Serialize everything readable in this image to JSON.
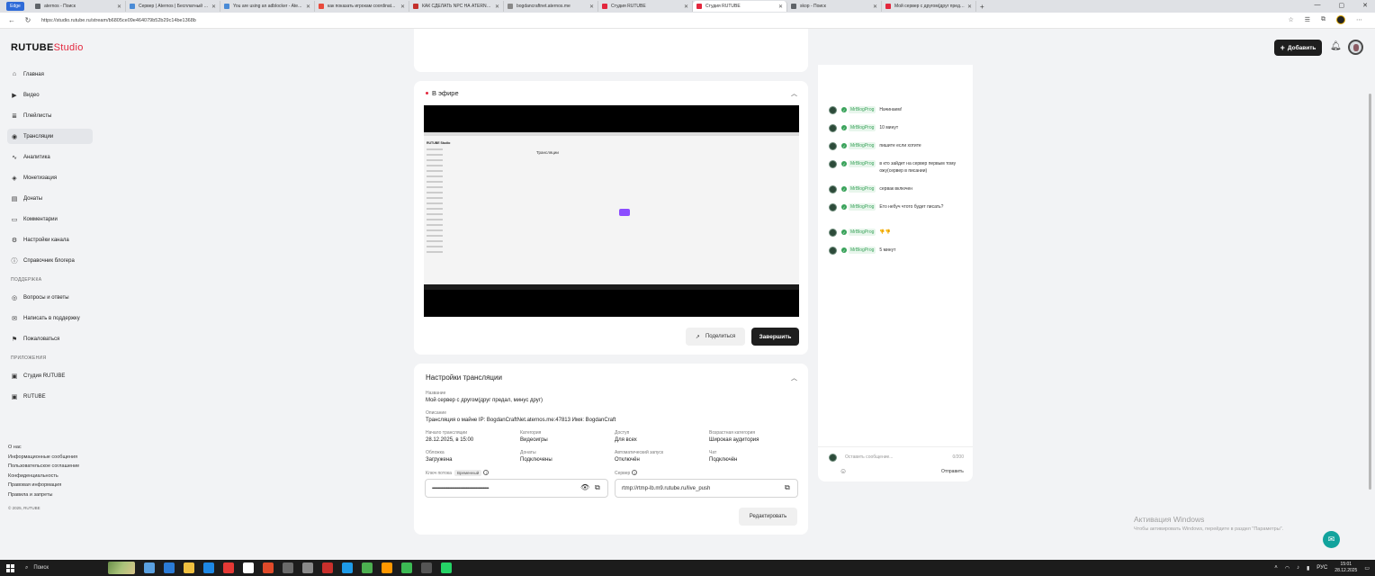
{
  "browser": {
    "edge_label": "Edge",
    "tabs": [
      {
        "title": "aternos - Поиск",
        "color": "#5f6368"
      },
      {
        "title": "Сервер | Aternos | Бесплатный с...",
        "color": "#4a8bd6"
      },
      {
        "title": "You are using an adblocker - Ate...",
        "color": "#4a8bd6"
      },
      {
        "title": "как показать игрокам coordinat...",
        "color": "#e84a3c"
      },
      {
        "title": "КАК СДЕЛАТЬ NPC НА ATERNOS...",
        "color": "#c4302b"
      },
      {
        "title": "bogdancraftnet.aternos.me",
        "color": "#888888"
      },
      {
        "title": "Студия RUTUBE",
        "color": "#e3273d"
      },
      {
        "title": "Студия RUTUBE",
        "color": "#e3273d"
      },
      {
        "title": "skop - Поиск",
        "color": "#5f6368"
      },
      {
        "title": "Мой сервер с другом(друг преда...",
        "color": "#e3273d"
      }
    ],
    "new_tab": "+",
    "window_controls": [
      "—",
      "▢",
      "✕"
    ],
    "url": "https://studio.rutube.ru/stream/b6805ce09e464079b52b29c14be1368b"
  },
  "header": {
    "logo_main": "RUTUBE",
    "logo_studio": "Studio",
    "add_label": "Добавить",
    "add_icon": "+"
  },
  "sidebar": {
    "items": [
      {
        "label": "Главная",
        "icon": "⌂",
        "name": "home"
      },
      {
        "label": "Видео",
        "icon": "▶",
        "name": "video"
      },
      {
        "label": "Плейлисты",
        "icon": "≣",
        "name": "playlists"
      },
      {
        "label": "Трансляции",
        "icon": "◉",
        "name": "streams"
      },
      {
        "label": "Аналитика",
        "icon": "∿",
        "name": "analytics"
      },
      {
        "label": "Монетизация",
        "icon": "◈",
        "name": "monetization"
      },
      {
        "label": "Донаты",
        "icon": "▤",
        "name": "donations"
      },
      {
        "label": "Комментарии",
        "icon": "▭",
        "name": "comments"
      },
      {
        "label": "Настройки канала",
        "icon": "⚙",
        "name": "channel-settings"
      },
      {
        "label": "Справочник блогера",
        "icon": "ⓘ",
        "name": "blogger-guide"
      }
    ],
    "support_title": "ПОДДЕРЖКА",
    "support_items": [
      {
        "label": "Вопросы и ответы",
        "icon": "◎",
        "name": "faq"
      },
      {
        "label": "Написать в поддержку",
        "icon": "✉",
        "name": "contact-support"
      },
      {
        "label": "Пожаловаться",
        "icon": "⚑",
        "name": "report"
      }
    ],
    "apps_title": "ПРИЛОЖЕНИЯ",
    "apps_items": [
      {
        "label": "Студия RUTUBE",
        "icon": "▣",
        "name": "studio-app"
      },
      {
        "label": "RUTUBE",
        "icon": "▣",
        "name": "rutube-app"
      }
    ],
    "footer_links": [
      "О нас",
      "Информационные сообщения",
      "Пользовательское соглашение",
      "Конфиденциальность",
      "Правовая информация",
      "Правила и запреты"
    ],
    "copyright": "© 2025, RUTUBE"
  },
  "live": {
    "title": "В эфире",
    "share_label": "Поделиться",
    "finish_label": "Завершить",
    "preview_title": "Трансляции",
    "preview_logo": "RUTUBE Studio"
  },
  "settings": {
    "title": "Настройки трансляции",
    "name_label": "Название",
    "name_value": "Мой сервер с другом(друг предал, минус друг)",
    "desc_label": "Описание",
    "desc_value": "Трансляция о майне IP: BogdanCraftNet.aternos.me:47813 Имя: BogdanCraft",
    "start_label": "Начало трансляции",
    "start_value": "28.12.2025, в 15:00",
    "category_label": "Категория",
    "category_value": "Видеоигры",
    "access_label": "Доступ",
    "access_value": "Для всех",
    "age_label": "Возрастная категория",
    "age_value": "Широкая аудитория",
    "cover_label": "Обложка",
    "cover_value": "Загружена",
    "donations_label": "Донаты",
    "donations_value": "Подключены",
    "autostart_label": "Автоматический запуск",
    "autostart_value": "Отключён",
    "chat_label": "Чат",
    "chat_value": "Подключён",
    "key_label": "Ключ потока",
    "key_badge": "Временный",
    "key_value": "••••••••••••••••••••••••••••••••••••••••••••••••••••••••••••••••••",
    "server_label": "Сервер",
    "server_value": "rtmp://rtmp-lb.m9.rutube.ru/live_push",
    "edit_label": "Редактировать"
  },
  "chat": {
    "messages": [
      {
        "user": "MrBlogProg",
        "text": "Начинаем!"
      },
      {
        "user": "MrBlogProg",
        "text": "10 минут"
      },
      {
        "user": "MrBlogProg",
        "text": "пишите если хотите"
      },
      {
        "user": "MrBlogProg",
        "text": "в кто зайдет на сервер первым тому ожу(сервер в писании)"
      },
      {
        "user": "MrBlogProg",
        "text": "сервак включен"
      },
      {
        "user": "MrBlogProg",
        "text": "Ето небуч чтото будет писать?"
      },
      {
        "user": "MrBlogProg",
        "text": "👎👎"
      },
      {
        "user": "MrBlogProg",
        "text": "5 минут"
      }
    ],
    "input_placeholder": "Оставить сообщение...",
    "counter": "0/200",
    "send_label": "Отправить"
  },
  "activation": {
    "line1": "Активация Windows",
    "line2": "Чтобы активировать Windows, перейдите в раздел \"Параметры\"."
  },
  "taskbar": {
    "search_label": "Поиск",
    "lang": "РУС",
    "time": "15:01",
    "date": "28.12.2025",
    "apps": [
      "#5aa0e0",
      "#2b7bd6",
      "#f0c040",
      "#1e88e5",
      "#e53935",
      "#ffffff",
      "#e04a2a",
      "#6a6a6a",
      "#8a8a8a",
      "#c9302c",
      "#1e9be8",
      "#4caf50",
      "#ff9800",
      "#3cba54",
      "#555555",
      "#25d366"
    ]
  }
}
